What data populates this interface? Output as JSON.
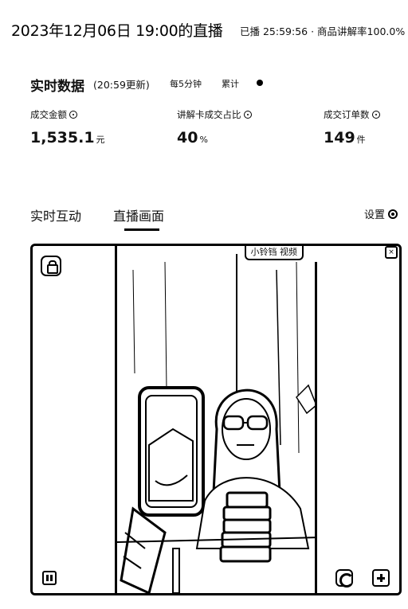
{
  "header": {
    "title": "2023年12月06日 19:00的直播",
    "meta": "已播 25:59:56 · 商品讲解率100.0%"
  },
  "realtime": {
    "title": "实时数据",
    "updated": "(20:59更新)",
    "interval": "每5分钟",
    "cumulative": "累计",
    "metrics": [
      {
        "label": "成交金额",
        "value": "1,535.1",
        "unit": "元"
      },
      {
        "label": "讲解卡成交占比",
        "value": "40",
        "unit": "%"
      },
      {
        "label": "成交订单数",
        "value": "149",
        "unit": "件"
      }
    ]
  },
  "tabs": [
    {
      "label": "实时互动",
      "active": false
    },
    {
      "label": "直播画面",
      "active": true
    }
  ],
  "settings_label": "设置",
  "player": {
    "overlay_text": "小铃铛 视频",
    "icons": [
      "shop-icon",
      "pause-icon",
      "refresh-icon",
      "expand-icon"
    ]
  }
}
